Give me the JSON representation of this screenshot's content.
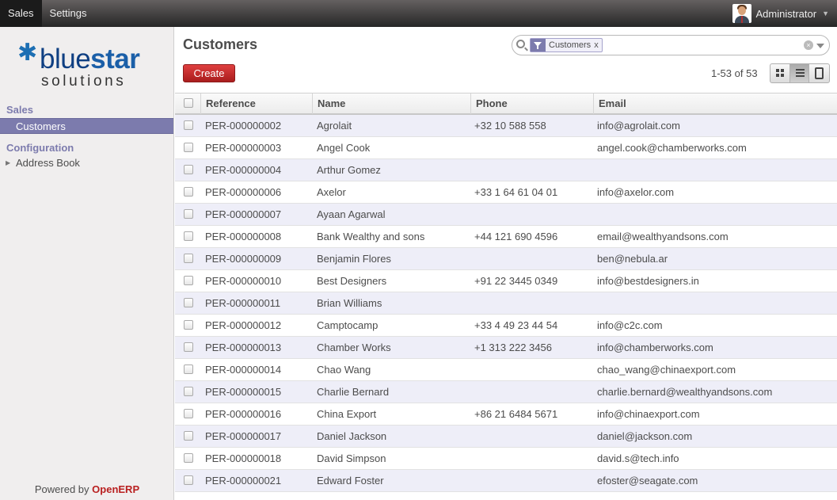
{
  "topbar": {
    "menus": [
      "Sales",
      "Settings"
    ],
    "user_name": "Administrator"
  },
  "sidebar": {
    "logo_part1": "blue",
    "logo_part2": "star",
    "logo_sub": "solutions",
    "section_sales": "Sales",
    "item_customers": "Customers",
    "section_configuration": "Configuration",
    "item_address_book": "Address Book",
    "powered_by": "Powered by",
    "powered_brand": "OpenERP"
  },
  "main": {
    "title": "Customers",
    "create_label": "Create",
    "search_facet": "Customers",
    "pager": "1-53 of 53"
  },
  "table": {
    "headers": [
      "Reference",
      "Name",
      "Phone",
      "Email"
    ],
    "rows": [
      [
        "PER-000000002",
        "Agrolait",
        "+32 10 588 558",
        "info@agrolait.com"
      ],
      [
        "PER-000000003",
        "Angel Cook",
        "",
        "angel.cook@chamberworks.com"
      ],
      [
        "PER-000000004",
        "Arthur Gomez",
        "",
        ""
      ],
      [
        "PER-000000006",
        "Axelor",
        "+33 1 64 61 04 01",
        "info@axelor.com"
      ],
      [
        "PER-000000007",
        "Ayaan Agarwal",
        "",
        ""
      ],
      [
        "PER-000000008",
        "Bank Wealthy and sons",
        "+44 121 690 4596",
        "email@wealthyandsons.com"
      ],
      [
        "PER-000000009",
        "Benjamin Flores",
        "",
        "ben@nebula.ar"
      ],
      [
        "PER-000000010",
        "Best Designers",
        "+91 22 3445 0349",
        "info@bestdesigners.in"
      ],
      [
        "PER-000000011",
        "Brian Williams",
        "",
        ""
      ],
      [
        "PER-000000012",
        "Camptocamp",
        "+33 4 49 23 44 54",
        "info@c2c.com"
      ],
      [
        "PER-000000013",
        "Chamber Works",
        "+1 313 222 3456",
        "info@chamberworks.com"
      ],
      [
        "PER-000000014",
        "Chao Wang",
        "",
        "chao_wang@chinaexport.com"
      ],
      [
        "PER-000000015",
        "Charlie Bernard",
        "",
        "charlie.bernard@wealthyandsons.com"
      ],
      [
        "PER-000000016",
        "China Export",
        "+86 21 6484 5671",
        "info@chinaexport.com"
      ],
      [
        "PER-000000017",
        "Daniel Jackson",
        "",
        "daniel@jackson.com"
      ],
      [
        "PER-000000018",
        "David Simpson",
        "",
        "david.s@tech.info"
      ],
      [
        "PER-000000021",
        "Edward Foster",
        "",
        "efoster@seagate.com"
      ]
    ]
  }
}
